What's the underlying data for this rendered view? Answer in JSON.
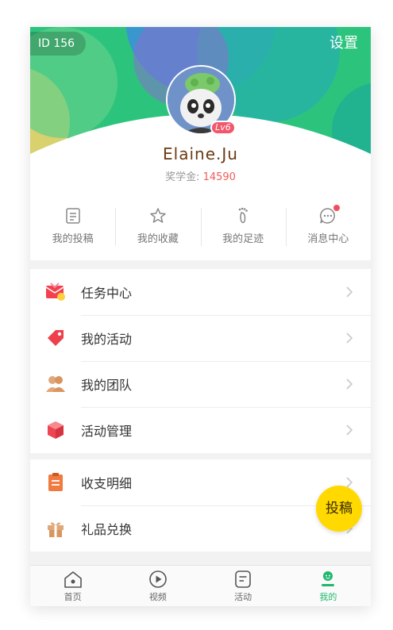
{
  "header": {
    "user_id": "ID 156",
    "settings_label": "设置",
    "username": "Elaine.Ju",
    "level": "Lv6",
    "scholarship_label": "奖学金: ",
    "scholarship_value": "14590"
  },
  "quick": [
    {
      "label": "我的投稿",
      "icon": "document-icon"
    },
    {
      "label": "我的收藏",
      "icon": "star-icon"
    },
    {
      "label": "我的足迹",
      "icon": "footprint-icon"
    },
    {
      "label": "消息中心",
      "icon": "message-icon",
      "badge": true
    }
  ],
  "menu_group_1": [
    {
      "label": "任务中心",
      "icon": "task-envelope-icon"
    },
    {
      "label": "我的活动",
      "icon": "tag-icon"
    },
    {
      "label": "我的团队",
      "icon": "team-icon"
    },
    {
      "label": "活动管理",
      "icon": "box-icon"
    }
  ],
  "menu_group_2": [
    {
      "label": "收支明细",
      "icon": "clipboard-icon"
    },
    {
      "label": "礼品兑换",
      "icon": "gift-icon"
    }
  ],
  "fab_label": "投稿",
  "tabs": [
    {
      "label": "首页",
      "icon": "home-icon"
    },
    {
      "label": "视频",
      "icon": "play-icon"
    },
    {
      "label": "活动",
      "icon": "activity-icon"
    },
    {
      "label": "我的",
      "icon": "profile-icon",
      "active": true
    }
  ],
  "colors": {
    "accent_green": "#1fb86e",
    "badge_red": "#f24e5a",
    "fab_yellow": "#ffd900",
    "name_brown": "#6b3a12",
    "value_red": "#f15b5b"
  }
}
